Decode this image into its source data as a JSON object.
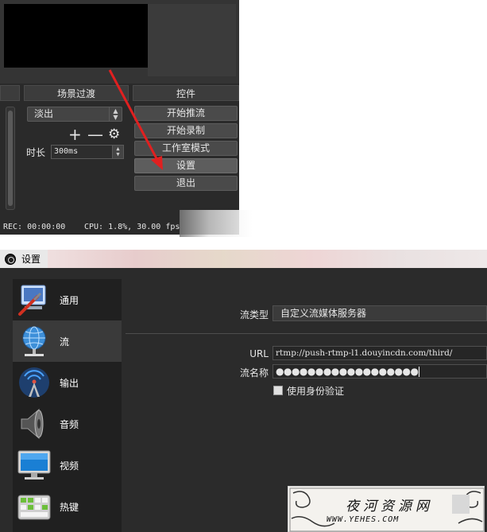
{
  "main_window": {
    "dock_headers": {
      "left": "",
      "transitions": "场景过渡",
      "controls": "控件"
    },
    "transition_select": {
      "value": "淡出"
    },
    "transition_toolbar": {
      "add": "+",
      "remove": "—",
      "settings": "⚙"
    },
    "duration": {
      "label": "时长",
      "value": "300ms"
    },
    "controls": {
      "start_streaming": "开始推流",
      "start_recording": "开始录制",
      "studio_mode": "工作室模式",
      "settings": "设置",
      "exit": "退出"
    },
    "status_bar": {
      "rec": "REC: 00:00:00",
      "cpu": "CPU: 1.8%, 30.00 fps"
    },
    "annotation_arrow_color": "#e02020"
  },
  "settings_dialog": {
    "title": "设置",
    "sidebar": {
      "items": [
        {
          "label": "通用",
          "icon": "general-settings-icon"
        },
        {
          "label": "流",
          "icon": "globe-network-icon"
        },
        {
          "label": "输出",
          "icon": "antenna-broadcast-icon"
        },
        {
          "label": "音频",
          "icon": "speaker-icon"
        },
        {
          "label": "视频",
          "icon": "monitor-icon"
        },
        {
          "label": "热键",
          "icon": "keyboard-icon"
        }
      ],
      "active_index": 1
    },
    "stream": {
      "stream_type_label": "流类型",
      "stream_type_value": "自定义流媒体服务器",
      "url_label": "URL",
      "url_value": "rtmp://push-rtmp-l1.douyincdn.com/third/",
      "key_label": "流名称",
      "key_value": "●●●●●●●●●●●●●●●●●●",
      "auth_checkbox_label": "使用身份验证",
      "auth_checked": false
    }
  },
  "watermark": {
    "cn": "夜河资源网",
    "en": "WWW.YEHES.COM"
  }
}
